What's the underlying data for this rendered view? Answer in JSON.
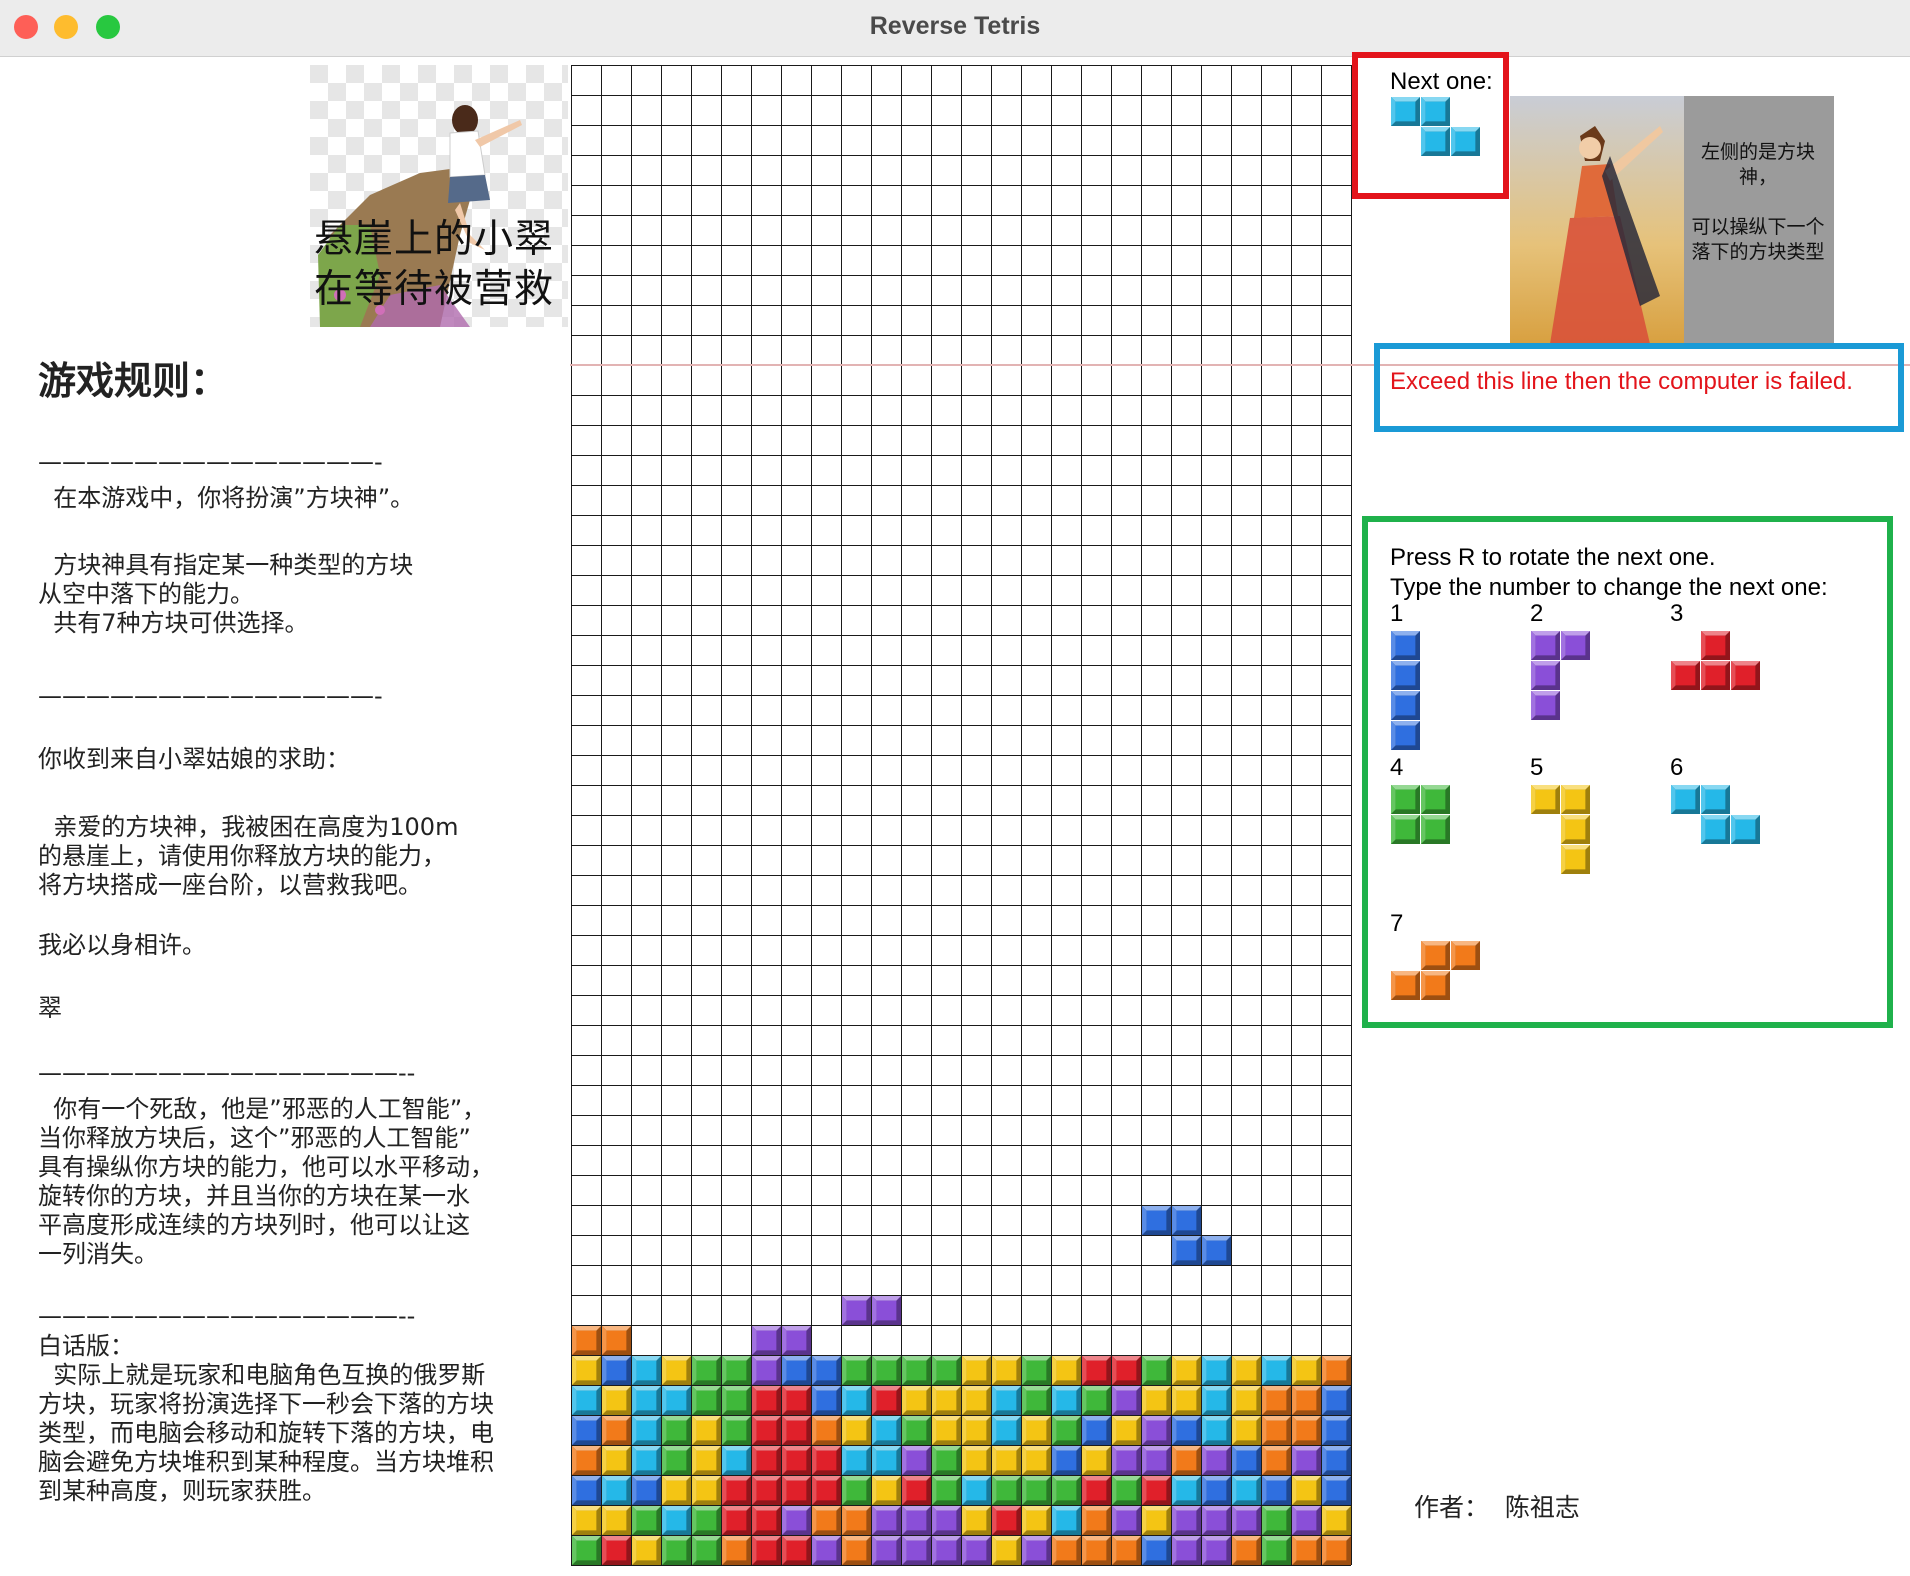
{
  "window": {
    "title": "Reverse Tetris",
    "buttons": [
      "close",
      "minimize",
      "zoom"
    ],
    "button_colors": {
      "close": "#fe5f57",
      "minimize": "#febc2e",
      "zoom": "#28c840"
    }
  },
  "colors": {
    "blue": "#2f6fe0",
    "purple": "#8a4fd8",
    "red": "#e0202a",
    "green": "#3fb83a",
    "yellow": "#f4c514",
    "cyan": "#25b8e8",
    "orange": "#f27a1a",
    "panel_red": "#e3141b",
    "panel_blue": "#1a9ad6",
    "panel_green": "#1fb14b",
    "fail_line": "#e2b3b3"
  },
  "cliff_picture": {
    "icon": "girl-on-cliff-picture",
    "caption_line1": "悬崖上的小翠",
    "caption_line2": "在等待被营救"
  },
  "rules": {
    "heading": "游戏规则：",
    "paragraphs": [
      "——————————————-",
      "  在本游戏中，你将扮演”方块神”。",
      "  方块神具有指定某一种类型的方块\n从空中落下的能力。\n  共有7种方块可供选择。",
      "——————————————-",
      "你收到来自小翠姑娘的求助：",
      "  亲爱的方块神，我被困在高度为100m\n的悬崖上，请使用你释放方块的能力，\n将方块搭成一座台阶，以营救我吧。",
      "我必以身相许。",
      "翠",
      "———————————————--",
      "  你有一个死敌，他是”邪恶的人工智能”，\n当你释放方块后，这个”邪恶的人工智能”\n具有操纵你方块的能力，他可以水平移动，\n旋转你的方块，并且当你的方块在某一水\n平高度形成连续的方块列时，他可以让这\n一列消失。",
      "———————————————--",
      "白话版：\n  实际上就是玩家和电脑角色互换的俄罗斯\n方块，玩家将扮演选择下一秒会下落的方块\n类型，而电脑会移动和旋转下落的方块，电\n脑会避免方块堆积到某种程度。当方块堆积\n到某种高度，则玩家获胜。"
    ]
  },
  "board": {
    "columns": 26,
    "rows": 50,
    "fail_line_row": 10,
    "falling_piece": {
      "type": 6,
      "color": "blue",
      "cells": [
        [
          38,
          19
        ],
        [
          38,
          20
        ],
        [
          39,
          20
        ],
        [
          39,
          21
        ]
      ]
    },
    "stack_rows": [
      "..........................",
      ".........PP...............",
      "OO....PP..................",
      "YBCYGGPBBGGGGYYGYRRGYCYCYO",
      "CYCCGGRRBCRYYYCGCGPYYCYOOB",
      "BOCGYGRROYCGYYCYGBYPBCYOOB",
      "OYCGYCRRRCCPGYYYBYPPOPBOPB",
      "BCBYYRRRRGYRGCGGGRGRCBCBYB",
      "YYGCGRRPOOPPPYRYCOPYPPPGPY",
      "GRYGGORRPOPPPPYPOOOBPPOGOO"
    ]
  },
  "next_piece": {
    "label": "Next one:",
    "type": 6,
    "color": "cyan",
    "shape": [
      [
        0,
        0
      ],
      [
        1,
        0
      ],
      [
        1,
        1
      ],
      [
        2,
        1
      ]
    ]
  },
  "goddess_picture": {
    "icon": "block-goddess-picture",
    "text": "左侧的是方块神，\n\n可以操纵下一个落下的方块类型"
  },
  "fail_notice": "Exceed this line then the computer is failed.",
  "controls": {
    "rotate_hint": "Press R to rotate the next one.",
    "type_hint": "Type the number to change the next one:",
    "pieces": [
      {
        "num": "1",
        "color": "blue",
        "shape": [
          [
            0,
            0
          ],
          [
            0,
            1
          ],
          [
            0,
            2
          ],
          [
            0,
            3
          ]
        ]
      },
      {
        "num": "2",
        "color": "purple",
        "shape": [
          [
            0,
            0
          ],
          [
            1,
            0
          ],
          [
            0,
            1
          ],
          [
            0,
            2
          ]
        ]
      },
      {
        "num": "3",
        "color": "red",
        "shape": [
          [
            1,
            0
          ],
          [
            0,
            1
          ],
          [
            1,
            1
          ],
          [
            2,
            1
          ]
        ]
      },
      {
        "num": "4",
        "color": "green",
        "shape": [
          [
            0,
            0
          ],
          [
            1,
            0
          ],
          [
            0,
            1
          ],
          [
            1,
            1
          ]
        ]
      },
      {
        "num": "5",
        "color": "yellow",
        "shape": [
          [
            0,
            0
          ],
          [
            1,
            0
          ],
          [
            1,
            1
          ],
          [
            1,
            2
          ]
        ]
      },
      {
        "num": "6",
        "color": "cyan",
        "shape": [
          [
            0,
            0
          ],
          [
            1,
            0
          ],
          [
            1,
            1
          ],
          [
            2,
            1
          ]
        ]
      },
      {
        "num": "7",
        "color": "orange",
        "shape": [
          [
            1,
            0
          ],
          [
            2,
            0
          ],
          [
            0,
            1
          ],
          [
            1,
            1
          ]
        ]
      }
    ]
  },
  "author": "作者：  陈祖志"
}
